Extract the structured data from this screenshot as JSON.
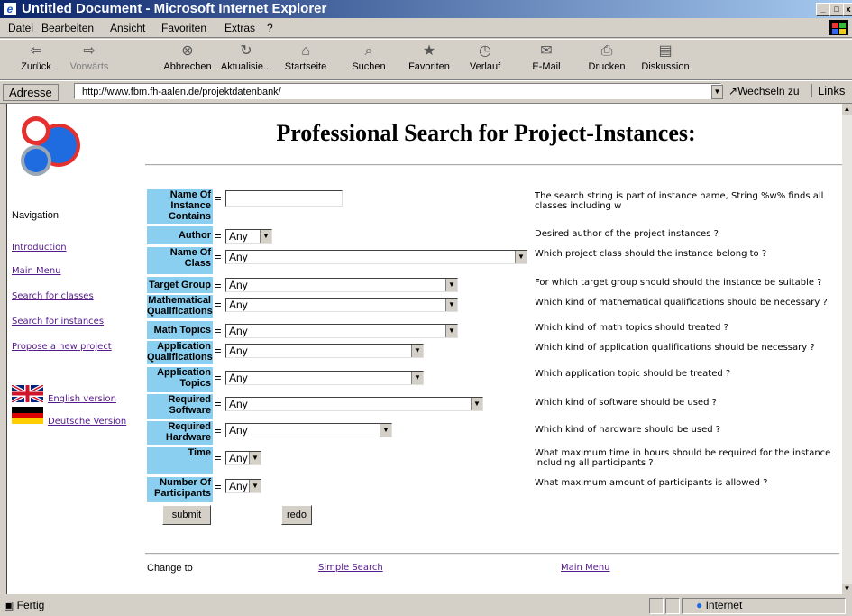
{
  "window": {
    "title": "Untitled Document - Microsoft Internet Explorer"
  },
  "menu": [
    "Datei",
    "Bearbeiten",
    "Ansicht",
    "Favoriten",
    "Extras",
    "?"
  ],
  "toolbar": [
    {
      "label": "Zurück",
      "icon": "back-arrow-icon",
      "enabled": true
    },
    {
      "label": "Vorwärts",
      "icon": "forward-arrow-icon",
      "enabled": false
    },
    {
      "label": "Abbrechen",
      "icon": "stop-icon",
      "enabled": true
    },
    {
      "label": "Aktualisie...",
      "icon": "refresh-icon",
      "enabled": true
    },
    {
      "label": "Startseite",
      "icon": "home-icon",
      "enabled": true
    },
    {
      "label": "Suchen",
      "icon": "search-icon",
      "enabled": true
    },
    {
      "label": "Favoriten",
      "icon": "favorites-icon",
      "enabled": true
    },
    {
      "label": "Verlauf",
      "icon": "history-icon",
      "enabled": true
    },
    {
      "label": "E-Mail",
      "icon": "mail-icon",
      "enabled": true
    },
    {
      "label": "Drucken",
      "icon": "print-icon",
      "enabled": true
    },
    {
      "label": "Diskussion",
      "icon": "discussion-icon",
      "enabled": true
    }
  ],
  "address": {
    "label": "Adresse",
    "url": "http://www.fbm.fh-aalen.de/projektdatenbank/",
    "go_label": "Wechseln zu",
    "links_label": "Links"
  },
  "page": {
    "title": "Professional Search for Project-Instances:",
    "nav_heading": "Navigation",
    "nav_links": [
      "Introduction",
      "Main Menu",
      "Search for classes",
      "Search for instances",
      "Propose a new project"
    ],
    "lang_links": [
      "English version",
      "Deutsche Version"
    ],
    "fields": [
      {
        "label": "Name Of Instance Contains",
        "value": "",
        "description": "The search string is part of instance name, String %w% finds all classes including w"
      },
      {
        "label": "Author",
        "value": "Any",
        "description": "Desired author of the project instances ?"
      },
      {
        "label": "Name Of Class",
        "value": "Any",
        "description": "Which project class should the instance belong to ?"
      },
      {
        "label": "Target Group",
        "value": "Any",
        "description": "For which target group should should the instance be suitable ?"
      },
      {
        "label": "Mathematical Qualifications",
        "value": "Any",
        "description": "Which kind of mathematical qualifications should be necessary ?"
      },
      {
        "label": "Math Topics",
        "value": "Any",
        "description": "Which kind of math topics should treated ?"
      },
      {
        "label": "Application Qualifications",
        "value": "Any",
        "description": "Which kind of application qualifications should be necessary ?"
      },
      {
        "label": "Application Topics",
        "value": "Any",
        "description": "Which application topic should be treated ?"
      },
      {
        "label": "Required Software",
        "value": "Any",
        "description": "Which kind of software should be used ?"
      },
      {
        "label": "Required Hardware",
        "value": "Any",
        "description": "Which kind of hardware should be used ?"
      },
      {
        "label": "Time",
        "value": "Any",
        "description": "What maximum time in hours should be required for the instance including all participants ?"
      },
      {
        "label": "Number Of Participants",
        "value": "Any",
        "description": "What maximum amount of participants is allowed ?"
      }
    ],
    "eq": "=",
    "submit_label": "submit",
    "redo_label": "redo",
    "footer": {
      "change_to": "Change to",
      "simple_search": "Simple Search",
      "main_menu": "Main Menu"
    }
  },
  "status": {
    "text": "Fertig",
    "zone": "Internet"
  }
}
